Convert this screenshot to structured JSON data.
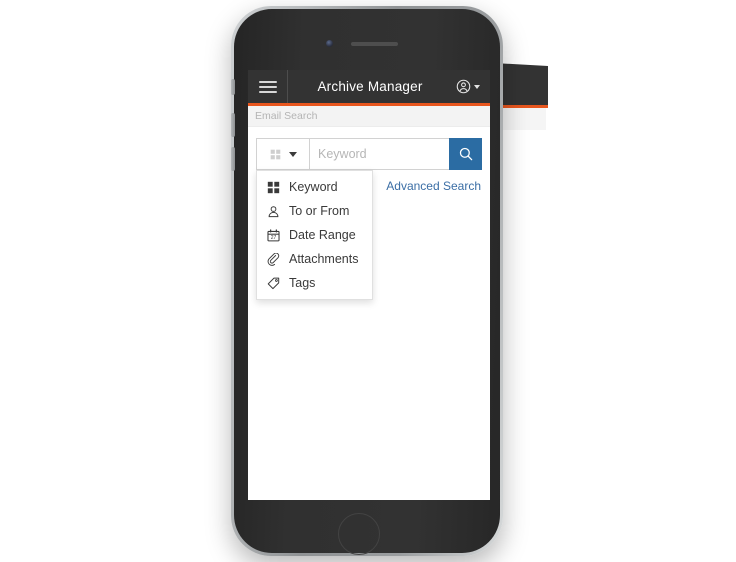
{
  "device": {
    "name": "smartphone-mockup",
    "camera": "front-camera-icon",
    "speaker": "earpiece-speaker",
    "home_button": "home-button"
  },
  "background_panel": {
    "name": "desktop-app-panel",
    "accent_color": "#e8561e",
    "dark_color": "#333333",
    "light_color": "#f5f5f5"
  },
  "app": {
    "header": {
      "menu_icon": "hamburger-menu-icon",
      "title": "Archive Manager",
      "account_icon": "user-avatar-icon",
      "account_caret": "chevron-down-icon",
      "accent_color": "#e8561e",
      "background_color": "#333333"
    },
    "sub_header": {
      "title": "Email Search"
    },
    "search": {
      "type_toggle": {
        "icon": "grid-icon",
        "caret": "caret-down-icon",
        "selected": "Keyword"
      },
      "keyword_placeholder": "Keyword",
      "keyword_value": "",
      "search_button_icon": "search-icon",
      "search_button_color": "#2b6ca3",
      "advanced_link": "Advanced Search",
      "advanced_link_color": "#3b6ea5"
    },
    "dropdown": {
      "items": [
        {
          "label": "Keyword",
          "icon": "grid-icon"
        },
        {
          "label": "To or From",
          "icon": "person-icon"
        },
        {
          "label": "Date Range",
          "icon": "calendar-icon"
        },
        {
          "label": "Attachments",
          "icon": "paperclip-icon"
        },
        {
          "label": "Tags",
          "icon": "tag-icon"
        }
      ]
    }
  }
}
